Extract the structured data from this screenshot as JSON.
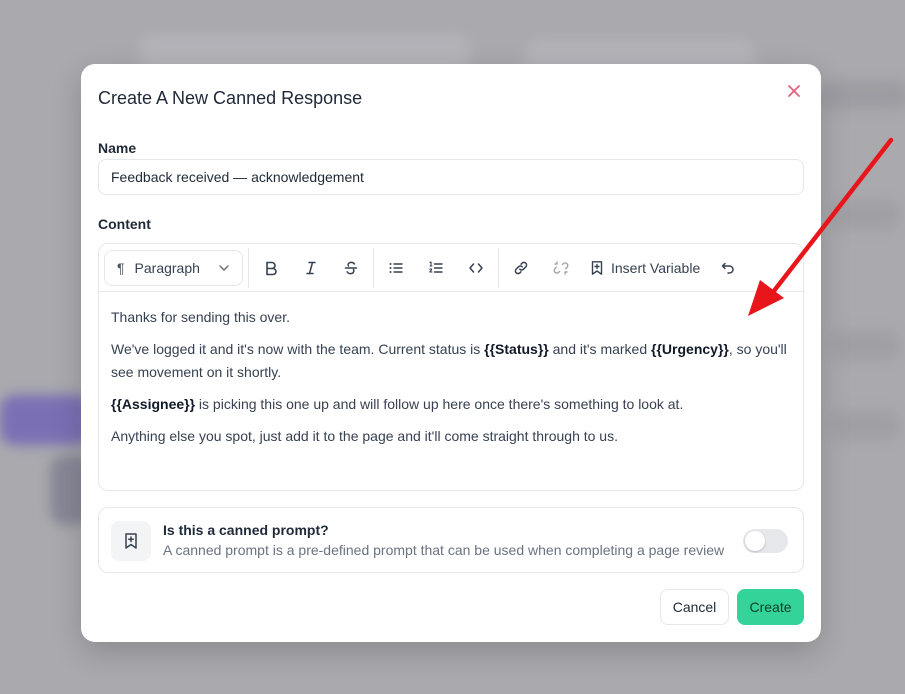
{
  "modal": {
    "title": "Create A New Canned Response",
    "name_label": "Name",
    "name_value": "Feedback received — acknowledgement",
    "content_label": "Content"
  },
  "toolbar": {
    "paragraph_label": "Paragraph",
    "insert_variable_label": "Insert Variable"
  },
  "content": {
    "p1": "Thanks for sending this over.",
    "p2_a": "We've logged it and it's now with the team. Current status is ",
    "p2_var1": "{{Status}}",
    "p2_b": " and it's marked ",
    "p2_var2": "{{Urgency}}",
    "p2_c": ", so you'll see movement on it shortly.",
    "p3_var": "{{Assignee}}",
    "p3_b": " is picking this one up and will follow up here once there's something to look at.",
    "p4": "Anything else you spot, just add it to the page and it'll come straight through to us."
  },
  "prompt": {
    "title": "Is this a canned prompt?",
    "description": "A canned prompt is a pre-defined prompt that can be used when completing a page review",
    "enabled": false
  },
  "actions": {
    "cancel_label": "Cancel",
    "create_label": "Create"
  },
  "colors": {
    "accent_create": "#34d399",
    "close_icon": "#e0607e",
    "annotation_arrow": "#e8161b"
  }
}
